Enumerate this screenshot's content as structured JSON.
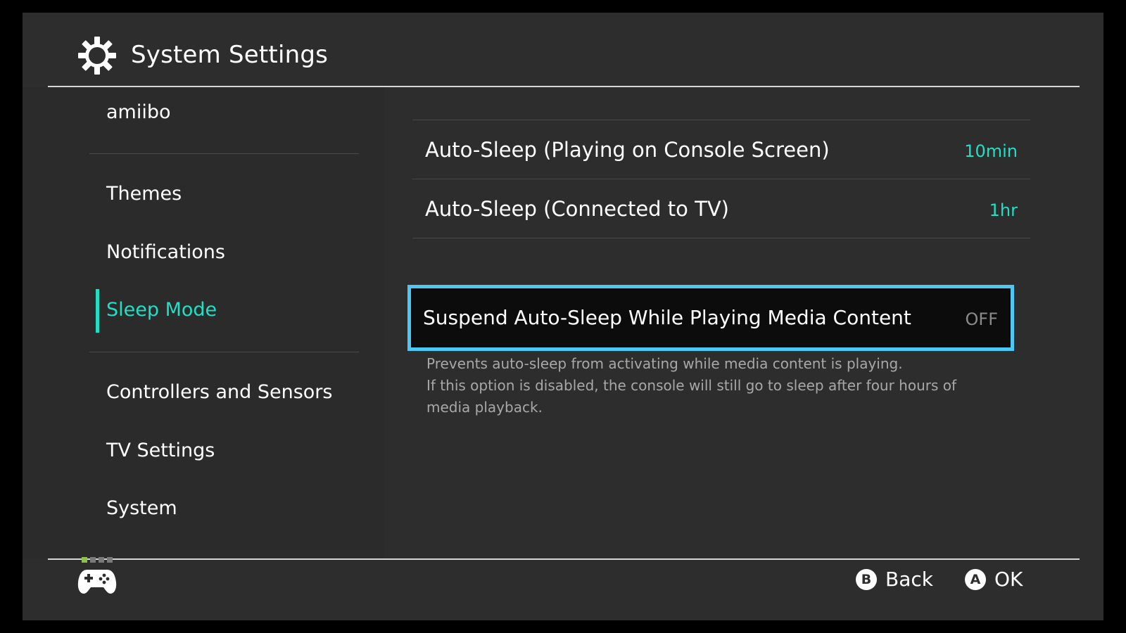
{
  "header": {
    "title": "System Settings",
    "icon": "gear-icon"
  },
  "sidebar": {
    "items": [
      {
        "label": "amiibo"
      },
      {
        "label": "Themes"
      },
      {
        "label": "Notifications"
      },
      {
        "label": "Sleep Mode",
        "active": true
      },
      {
        "label": "Controllers and Sensors"
      },
      {
        "label": "TV Settings"
      },
      {
        "label": "System"
      }
    ]
  },
  "settings": {
    "rows": [
      {
        "label": "Auto-Sleep (Playing on Console Screen)",
        "value": "10min"
      },
      {
        "label": "Auto-Sleep (Connected to TV)",
        "value": "1hr"
      }
    ],
    "selected": {
      "label": "Suspend Auto-Sleep While Playing Media Content",
      "value": "OFF"
    },
    "description": [
      "Prevents auto-sleep from activating while media content is playing.",
      "If this option is disabled, the console will still go to sleep after four hours of",
      "media playback."
    ]
  },
  "footer": {
    "back": {
      "button": "B",
      "label": "Back"
    },
    "ok": {
      "button": "A",
      "label": "OK"
    },
    "player_indicator_icon": "controller-icon"
  },
  "colors": {
    "background": "#2d2d2d",
    "accent": "#1fe0c4",
    "selection_border": "#4cc8f2",
    "player_led": "#8bc34a"
  }
}
